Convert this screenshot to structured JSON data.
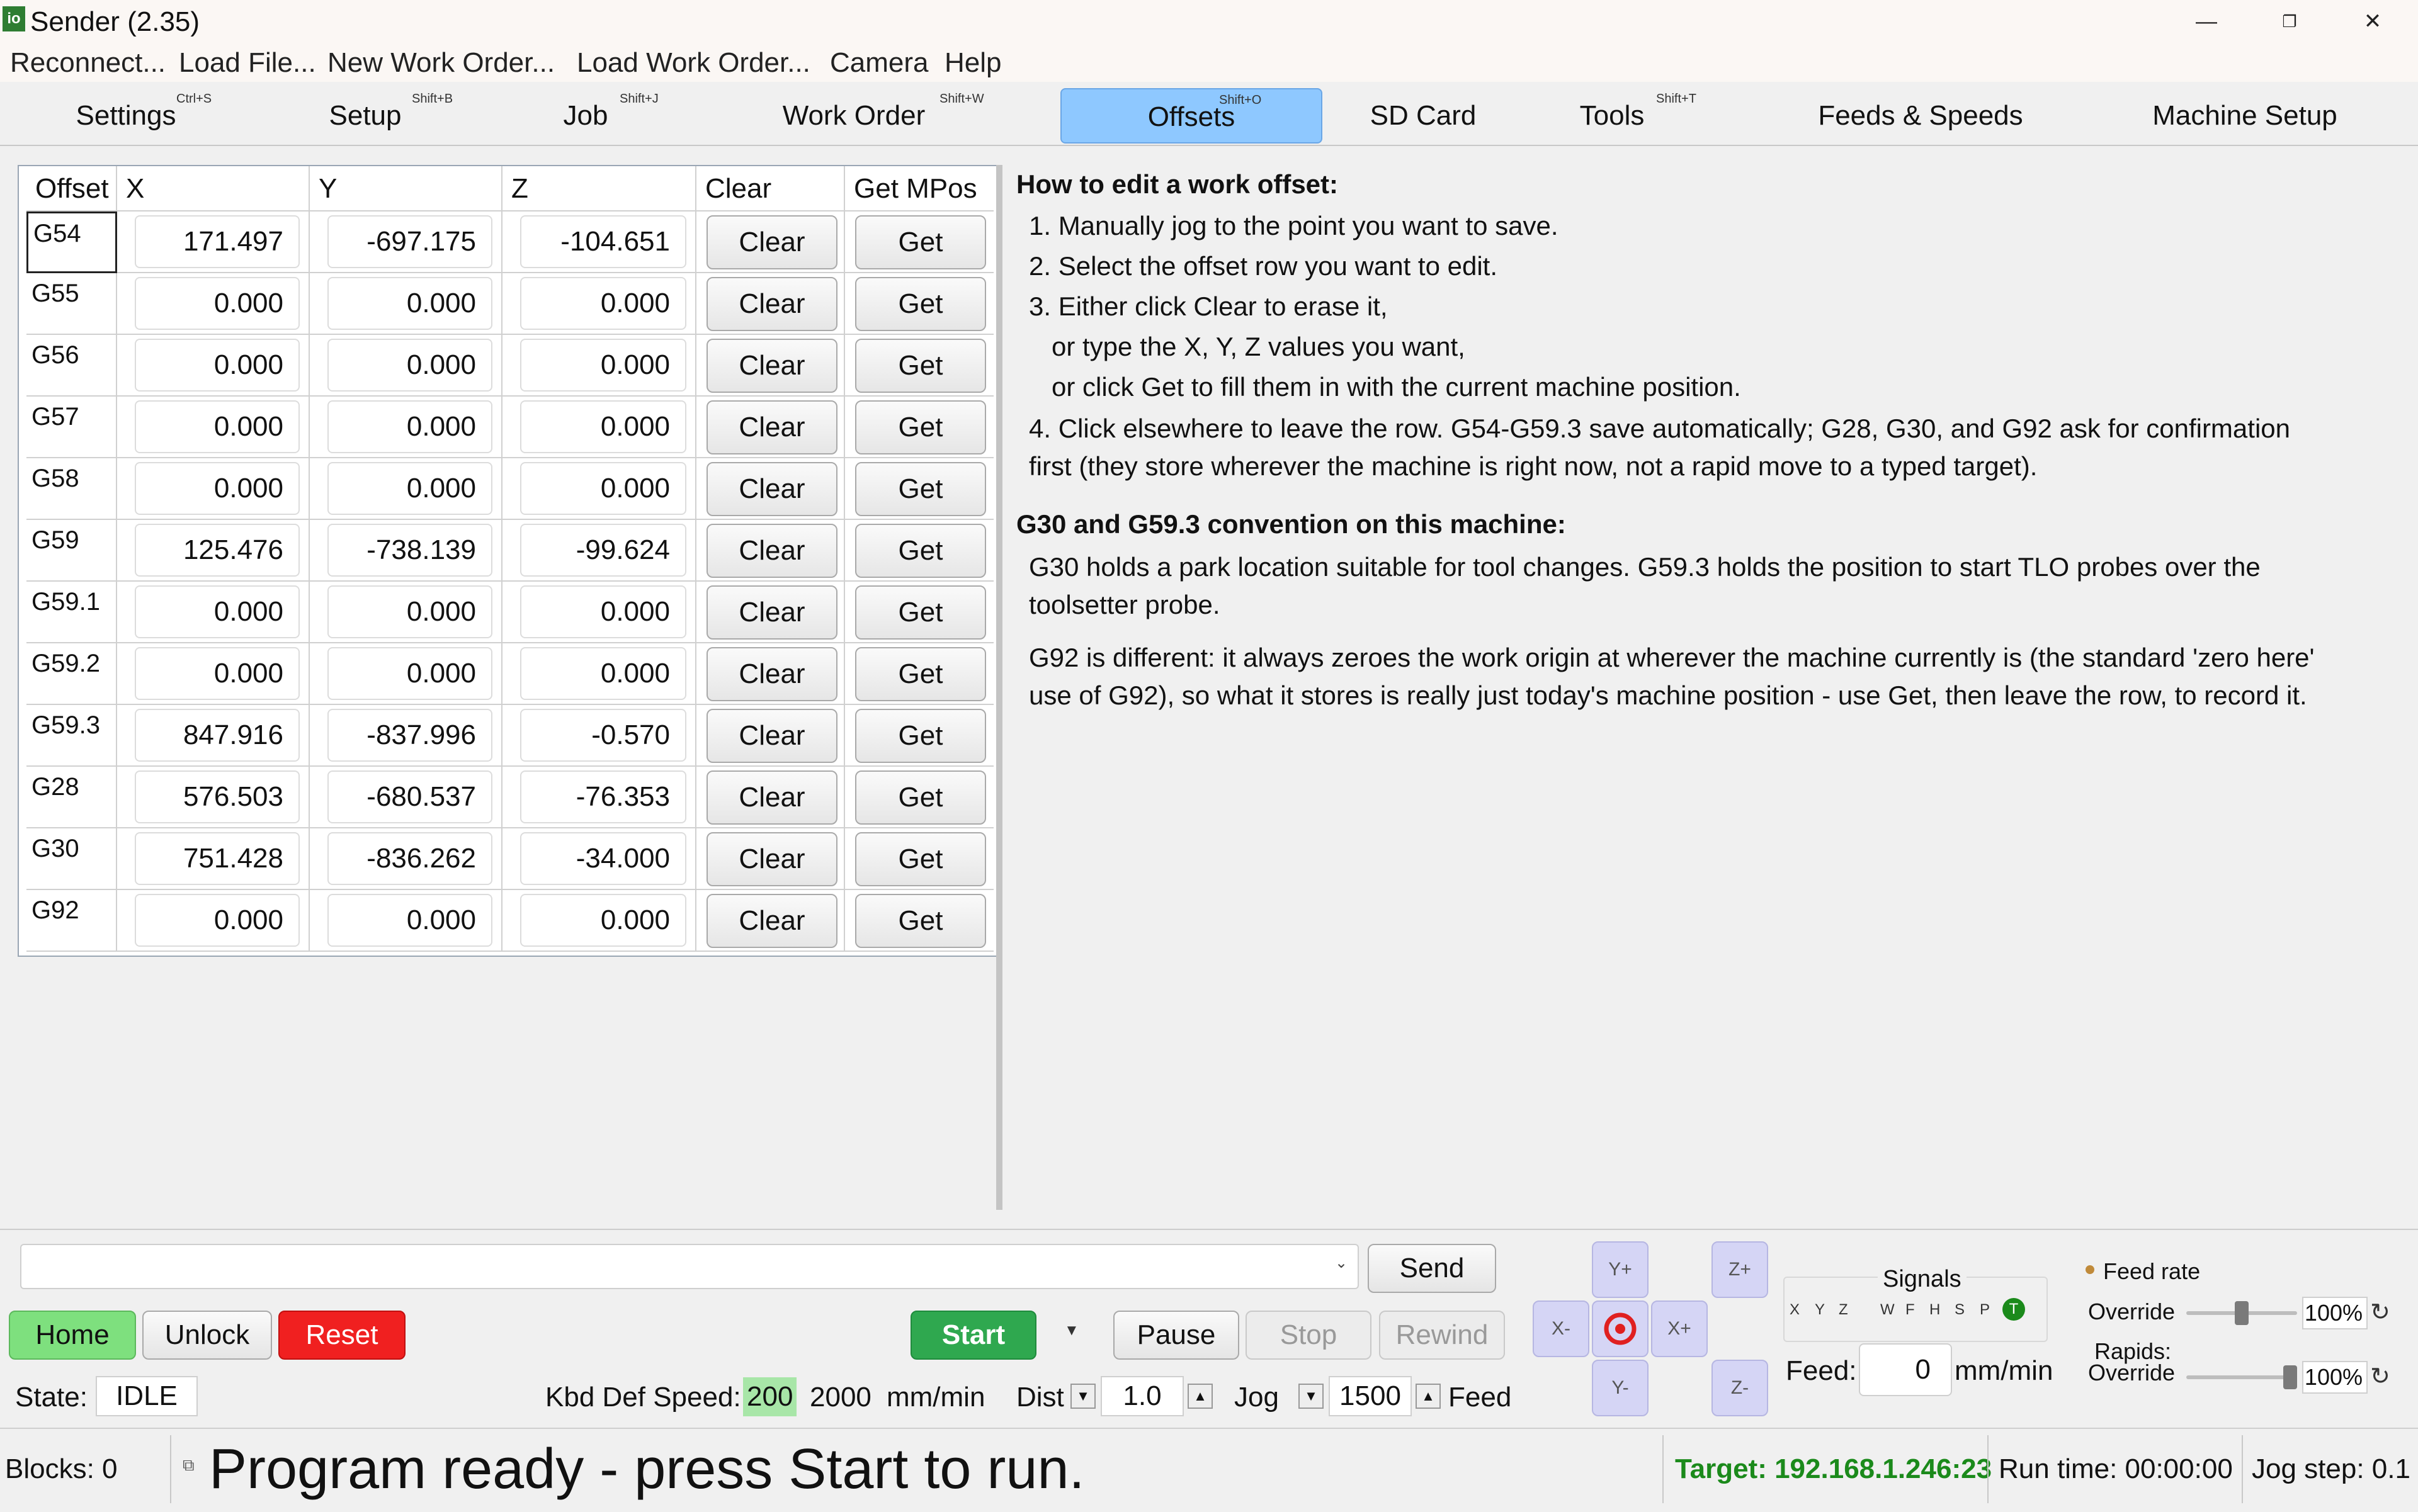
{
  "window": {
    "title": "Sender (2.35)",
    "icon_text": "io",
    "minimize": "—",
    "restore": "❐",
    "close": "✕"
  },
  "menu": [
    "Reconnect...",
    "Load File...",
    "New Work Order...",
    "Load Work Order...",
    "Camera",
    "Help"
  ],
  "tabs": [
    {
      "label": "Settings",
      "shortcut": "Ctrl+S"
    },
    {
      "label": "Setup",
      "shortcut": "Shift+B"
    },
    {
      "label": "Job",
      "shortcut": "Shift+J"
    },
    {
      "label": "Work Order",
      "shortcut": "Shift+W"
    },
    {
      "label": "Offsets",
      "shortcut": "Shift+O"
    },
    {
      "label": "SD Card",
      "shortcut": ""
    },
    {
      "label": "Tools",
      "shortcut": "Shift+T"
    },
    {
      "label": "Feeds & Speeds",
      "shortcut": ""
    },
    {
      "label": "Machine Setup",
      "shortcut": ""
    }
  ],
  "table": {
    "headers": [
      "Offset",
      "X",
      "Y",
      "Z",
      "Clear",
      "Get MPos"
    ],
    "clear_label": "Clear",
    "get_label": "Get",
    "rows": [
      {
        "name": "G54",
        "x": "171.497",
        "y": "-697.175",
        "z": "-104.651"
      },
      {
        "name": "G55",
        "x": "0.000",
        "y": "0.000",
        "z": "0.000"
      },
      {
        "name": "G56",
        "x": "0.000",
        "y": "0.000",
        "z": "0.000"
      },
      {
        "name": "G57",
        "x": "0.000",
        "y": "0.000",
        "z": "0.000"
      },
      {
        "name": "G58",
        "x": "0.000",
        "y": "0.000",
        "z": "0.000"
      },
      {
        "name": "G59",
        "x": "125.476",
        "y": "-738.139",
        "z": "-99.624"
      },
      {
        "name": "G59.1",
        "x": "0.000",
        "y": "0.000",
        "z": "0.000"
      },
      {
        "name": "G59.2",
        "x": "0.000",
        "y": "0.000",
        "z": "0.000"
      },
      {
        "name": "G59.3",
        "x": "847.916",
        "y": "-837.996",
        "z": "-0.570"
      },
      {
        "name": "G28",
        "x": "576.503",
        "y": "-680.537",
        "z": "-76.353"
      },
      {
        "name": "G30",
        "x": "751.428",
        "y": "-836.262",
        "z": "-34.000"
      },
      {
        "name": "G92",
        "x": "0.000",
        "y": "0.000",
        "z": "0.000"
      }
    ]
  },
  "help": {
    "heading1": "How to edit a work offset:",
    "l1": "1. Manually jog to the point you want to save.",
    "l2": "2. Select the offset row you want to edit.",
    "l3": "3. Either click Clear to erase it,",
    "l3b": "or type the X, Y, Z values you want,",
    "l3c": "or click Get to fill them in with the current machine position.",
    "l4": "4. Click elsewhere to leave the row. G54-G59.3 save automatically; G28, G30, and G92 ask for confirmation",
    "l4b": "first (they store wherever the machine is right now, not a rapid move to a typed target).",
    "heading2": "G30 and G59.3 convention on this machine:",
    "p1a": "G30 holds a park location suitable for tool changes. G59.3 holds the position to start TLO probes over the",
    "p1b": "toolsetter probe.",
    "p2a": "G92 is different: it always zeroes the work origin at wherever the machine currently is (the standard 'zero here'",
    "p2b": "use of G92), so what it stores is really just today's machine position - use Get, then leave the row, to record it."
  },
  "controls": {
    "command_value": "",
    "send": "Send",
    "home": "Home",
    "unlock": "Unlock",
    "reset": "Reset",
    "start": "Start",
    "pause": "Pause",
    "stop": "Stop",
    "rewind": "Rewind",
    "state_label": "State:",
    "state_value": "IDLE",
    "kbd_label": "Kbd Def Speed:",
    "kbd_speed": "200",
    "kbd_speed2": "2000",
    "kbd_units": "mm/min",
    "dist_label": "Dist",
    "dist_value": "1.0",
    "jog_label": "Jog",
    "jog_feed_value": "1500",
    "feed_label": "Feed",
    "jog": {
      "yplus": "Y+",
      "yminus": "Y-",
      "xplus": "X+",
      "xminus": "X-",
      "zplus": "Z+",
      "zminus": "Z-"
    },
    "signals_title": "Signals",
    "signals": [
      "X",
      "Y",
      "Z",
      "W",
      "F",
      "H",
      "S",
      "P",
      "T"
    ],
    "feed_field_label": "Feed:",
    "feed_field_value": "0",
    "feed_field_units": "mm/min",
    "feedrate_title": "Feed rate",
    "override_label": "Override",
    "feed_override": "100%",
    "feed_override_level": 0.5,
    "rapids_label": "Rapids:",
    "rapids_override_label": "Override",
    "rapids_override": "100%",
    "rapids_override_level": 1.0,
    "colors": {
      "home": "#7ee07e",
      "reset": "#f02020",
      "start": "#2fa84f",
      "kbd_highlight": "#a8e6a8",
      "active_tab": "#8ec8ff",
      "target": "#1b8a1b"
    }
  },
  "status": {
    "blocks": "Blocks: 0",
    "message": "Program ready - press Start to run.",
    "target": "Target: 192.168.1.246:23",
    "runtime": "Run time: 00:00:00",
    "jogstep": "Jog step: 0.1"
  }
}
